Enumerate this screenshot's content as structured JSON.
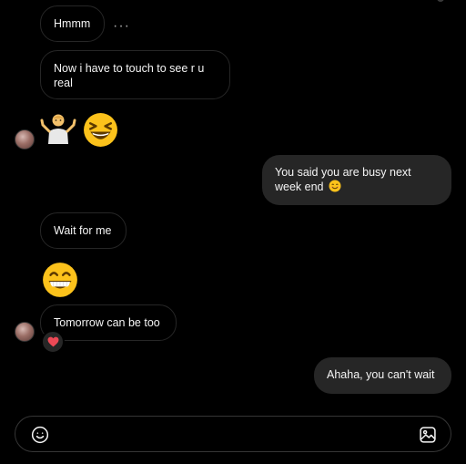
{
  "messages": {
    "m1": "Hmmm",
    "m2": "Now i have to touch to see r u real",
    "m3": "You said you are busy next week end",
    "m4": "Wait for me",
    "m5": "Tomorrow can be too",
    "m6": "Ahaha, you can't wait"
  },
  "more_options": "···",
  "composer": {
    "placeholder": "",
    "value": ""
  },
  "icons": {
    "emoji_picker": "smiley-face-icon",
    "add_photo": "image-icon",
    "reaction": "heart-icon"
  },
  "colors": {
    "outgoing_bubble": "#262626",
    "incoming_border": "#262626",
    "reaction_heart": "#ed4956"
  }
}
